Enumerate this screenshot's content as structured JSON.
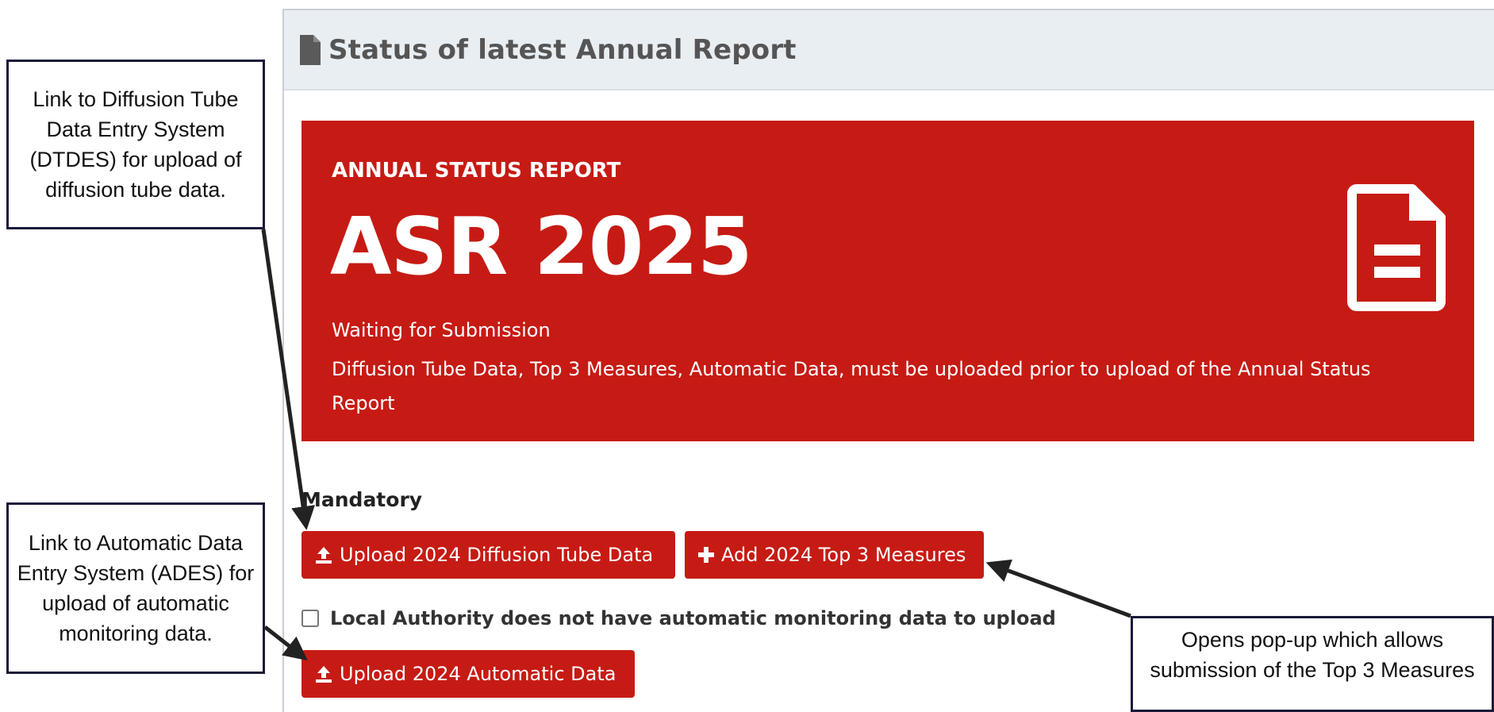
{
  "panel": {
    "header_title": "Status of latest Annual Report",
    "header_icon": "file-icon"
  },
  "asr": {
    "kicker": "ANNUAL STATUS REPORT",
    "title": "ASR 2025",
    "status": "Waiting for Submission",
    "note": "Diffusion Tube Data, Top 3 Measures, Automatic Data, must be uploaded prior to upload of the Annual Status Report",
    "icon": "file-text-icon",
    "color": "#c61b14"
  },
  "mandatory_label": "Mandatory",
  "buttons": {
    "upload_diffusion": "Upload 2024 Diffusion Tube Data",
    "add_top3": "Add 2024 Top 3 Measures",
    "upload_automatic": "Upload 2024 Automatic Data"
  },
  "checkbox": {
    "label": "Local Authority does not have automatic monitoring data to upload",
    "checked": false
  },
  "callouts": {
    "dtdes": "Link to Diffusion Tube Data Entry System (DTDES) for upload of diffusion tube data.",
    "ades": "Link to Automatic Data Entry System (ADES) for upload of automatic monitoring data.",
    "popup": "Opens pop-up which allows submission of the Top 3 Measures"
  }
}
